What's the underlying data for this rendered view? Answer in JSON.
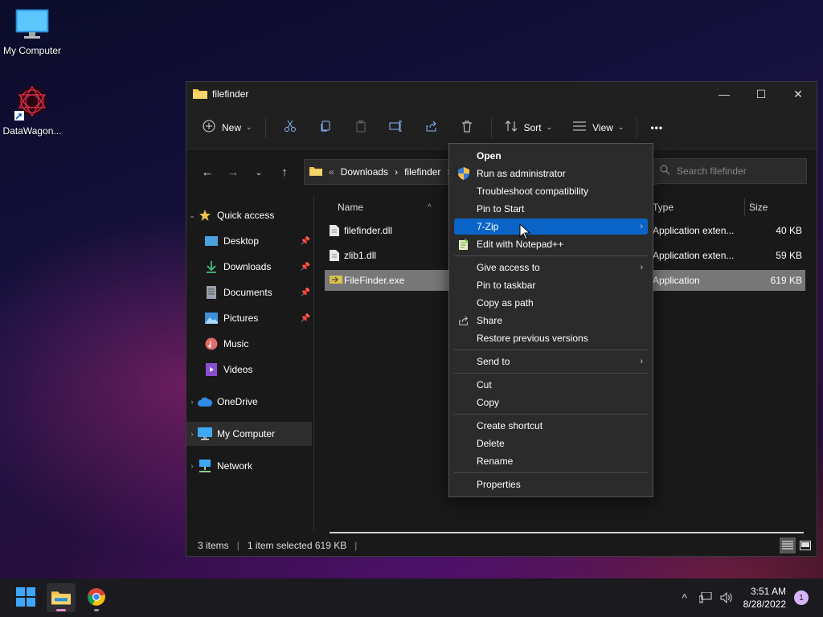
{
  "desktop": {
    "icons": [
      {
        "label": "My Computer"
      },
      {
        "label": "DataWagon..."
      }
    ]
  },
  "window": {
    "title": "filefinder",
    "controls": {
      "minimize": "—",
      "maximize": "☐",
      "close": "✕"
    },
    "toolbar": {
      "new_label": "New",
      "sort_label": "Sort",
      "view_label": "View",
      "more_label": "•••"
    },
    "address": {
      "overflow": "«",
      "crumbs": [
        "Downloads",
        "filefinder"
      ],
      "separator": "›"
    },
    "search": {
      "placeholder": "Search filefinder"
    },
    "sidebar": {
      "quick_access": "Quick access",
      "items": [
        {
          "label": "Desktop",
          "pinned": true
        },
        {
          "label": "Downloads",
          "pinned": true
        },
        {
          "label": "Documents",
          "pinned": true
        },
        {
          "label": "Pictures",
          "pinned": true
        },
        {
          "label": "Music",
          "pinned": false
        },
        {
          "label": "Videos",
          "pinned": false
        }
      ],
      "onedrive": "OneDrive",
      "mycomputer": "My Computer",
      "network": "Network"
    },
    "columns": {
      "name": "Name",
      "type": "Type",
      "size": "Size"
    },
    "files": [
      {
        "name": "filefinder.dll",
        "type": "Application exten...",
        "size": "40 KB"
      },
      {
        "name": "zlib1.dll",
        "type": "Application exten...",
        "size": "59 KB"
      },
      {
        "name": "FileFinder.exe",
        "type": "Application",
        "size": "619 KB",
        "selected": true
      }
    ],
    "status": {
      "count": "3 items",
      "selection": "1 item selected  619 KB",
      "divider": "|"
    }
  },
  "context_menu": {
    "groups": [
      [
        "Open",
        "Run as administrator",
        "Troubleshoot compatibility",
        "Pin to Start",
        "7-Zip",
        "Edit with Notepad++"
      ],
      [
        "Give access to",
        "Pin to taskbar",
        "Copy as path",
        "Share",
        "Restore previous versions"
      ],
      [
        "Send to"
      ],
      [
        "Cut",
        "Copy"
      ],
      [
        "Create shortcut",
        "Delete",
        "Rename"
      ],
      [
        "Properties"
      ]
    ],
    "highlighted": "7-Zip",
    "submenu_arrow": "›"
  },
  "taskbar": {
    "time": "3:51 AM",
    "date": "8/28/2022",
    "notifications": "1",
    "tray_chevron": "^"
  },
  "colors": {
    "highlight": "#0a64c8",
    "selected_row": "#777777",
    "folder": "#f2c14e"
  }
}
